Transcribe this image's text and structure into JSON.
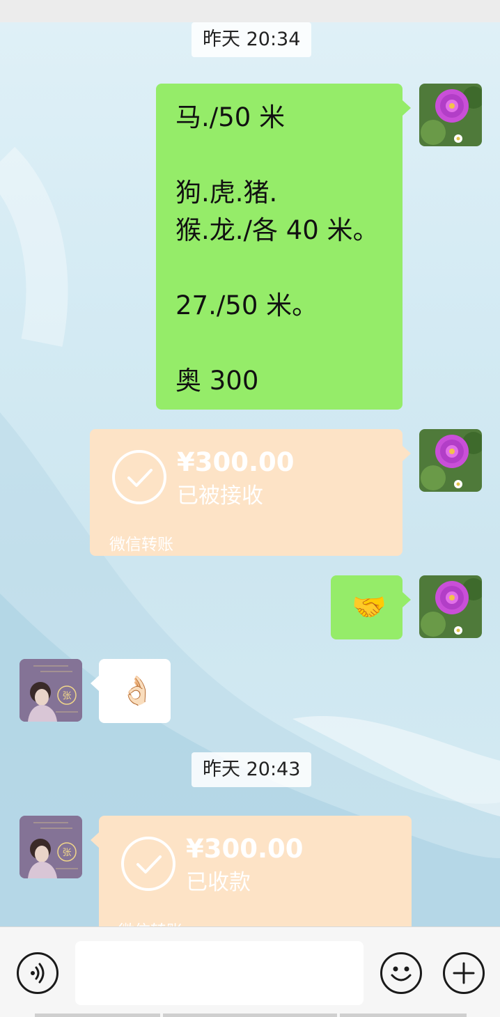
{
  "timestamps": [
    "昨天 20:34",
    "昨天 20:43"
  ],
  "messages": {
    "text_message": "马./50 米\n\n狗.虎.猪.\n猴.龙./各 40 米。\n\n27./50 米。\n\n奥 300",
    "sent_transfer": {
      "amount": "¥300.00",
      "status": "已被接收",
      "footer": "微信转账"
    },
    "handshake_emoji": "🤝",
    "ok_emoji": "👌🏻",
    "received_transfer": {
      "amount": "¥300.00",
      "status": "已收款",
      "footer": "微信转账"
    }
  },
  "avatars": {
    "self_icon": "purple-flower-avatar",
    "contact_icon": "woman-portrait-avatar",
    "contact_badge": "张"
  },
  "bottom_bar": {
    "voice_icon": "voice-icon",
    "emoji_icon": "emoji-icon",
    "plus_icon": "plus-icon",
    "input_value": ""
  },
  "colors": {
    "sent_bubble": "#95ec69",
    "transfer_bubble": "#fde3c6",
    "received_bubble": "#ffffff"
  }
}
